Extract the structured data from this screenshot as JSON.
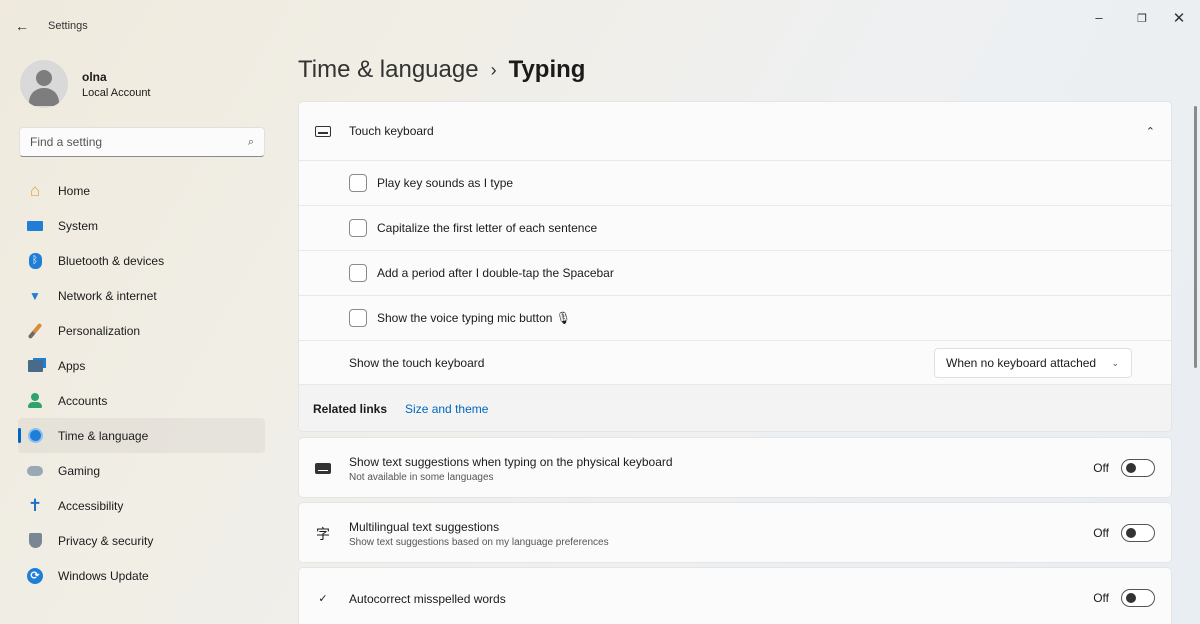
{
  "window": {
    "title": "Settings",
    "back": "←",
    "minimize": "–",
    "maximize": "❐",
    "close": "✕"
  },
  "profile": {
    "name": "olna",
    "account_type": "Local Account"
  },
  "search": {
    "placeholder": "Find a setting",
    "icon": "⌕"
  },
  "sidebar": {
    "items": [
      {
        "label": "Home",
        "icon": "home-icon",
        "glyph": "⌂",
        "color": "#e8a33a"
      },
      {
        "label": "System",
        "icon": "system-icon",
        "glyph": "▬",
        "color": "#1f7fd6"
      },
      {
        "label": "Bluetooth & devices",
        "icon": "bluetooth-icon",
        "glyph": "ᛒ",
        "color": "#1f7fd6"
      },
      {
        "label": "Network & internet",
        "icon": "wifi-icon",
        "glyph": "▼",
        "color": "#1f7fd6"
      },
      {
        "label": "Personalization",
        "icon": "brush-icon",
        "glyph": "⟋",
        "color": "#d98b3a"
      },
      {
        "label": "Apps",
        "icon": "apps-icon",
        "glyph": "■",
        "color": "#4a6a8a"
      },
      {
        "label": "Accounts",
        "icon": "accounts-icon",
        "glyph": "●",
        "color": "#2fa36b"
      },
      {
        "label": "Time & language",
        "icon": "globe-clock-icon",
        "glyph": "◔",
        "color": "#1f7fd6",
        "active": true
      },
      {
        "label": "Gaming",
        "icon": "gamepad-icon",
        "glyph": "⊷",
        "color": "#7c8da0"
      },
      {
        "label": "Accessibility",
        "icon": "accessibility-icon",
        "glyph": "✝",
        "color": "#1f6fc8"
      },
      {
        "label": "Privacy & security",
        "icon": "shield-icon",
        "glyph": "⛨",
        "color": "#6e7b8a"
      },
      {
        "label": "Windows Update",
        "icon": "update-icon",
        "glyph": "⟳",
        "color": "#1f7fd6"
      }
    ]
  },
  "breadcrumb": {
    "parent": "Time & language",
    "separator": "›",
    "current": "Typing"
  },
  "touch_keyboard": {
    "title": "Touch keyboard",
    "expanded_icon": "⌃",
    "options": [
      {
        "label": "Play key sounds as I type",
        "checked": false
      },
      {
        "label": "Capitalize the first letter of each sentence",
        "checked": false
      },
      {
        "label": "Add a period after I double-tap the Spacebar",
        "checked": false
      },
      {
        "label": "Show the voice typing mic button 🎙",
        "checked": false
      }
    ],
    "show_keyboard": {
      "label": "Show the touch keyboard",
      "value": "When no keyboard attached",
      "chevron": "⌄"
    },
    "related": {
      "title": "Related links",
      "link": "Size and theme"
    }
  },
  "settings": [
    {
      "title": "Show text suggestions when typing on the physical keyboard",
      "subtitle": "Not available in some languages",
      "state": "Off",
      "icon": "keyboard-icon"
    },
    {
      "title": "Multilingual text suggestions",
      "subtitle": "Show text suggestions based on my language preferences",
      "state": "Off",
      "icon": "language-icon",
      "glyph": "字"
    },
    {
      "title": "Autocorrect misspelled words",
      "subtitle": "",
      "state": "Off",
      "icon": "autocorrect-icon",
      "glyph": "✓"
    }
  ]
}
